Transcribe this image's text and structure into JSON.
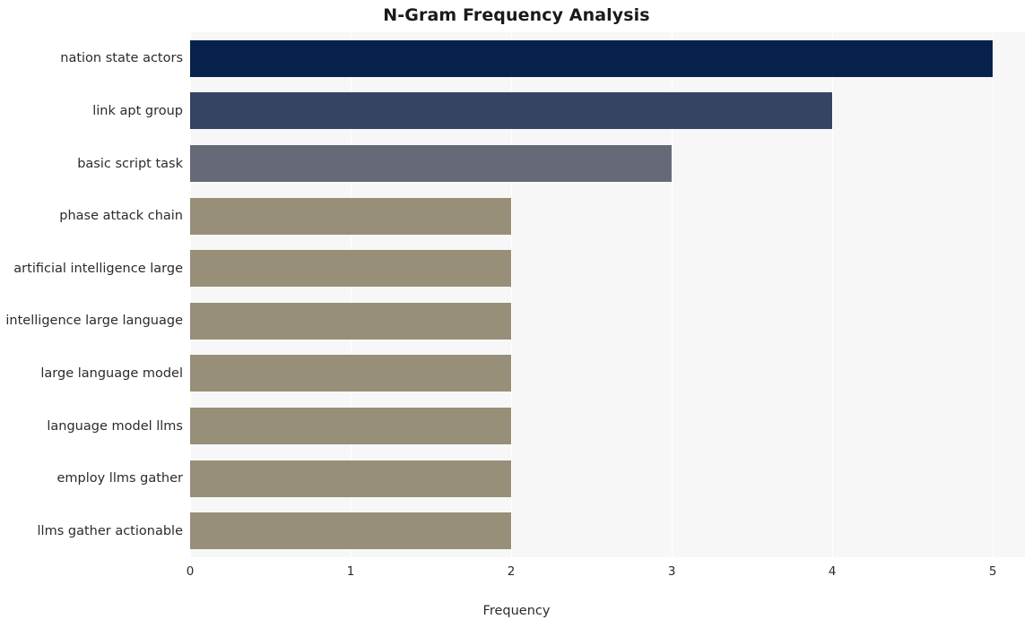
{
  "chart_data": {
    "type": "bar",
    "orientation": "horizontal",
    "title": "N-Gram Frequency Analysis",
    "xlabel": "Frequency",
    "ylabel": "",
    "categories": [
      "nation state actors",
      "link apt group",
      "basic script task",
      "phase attack chain",
      "artificial intelligence large",
      "intelligence large language",
      "large language model",
      "language model llms",
      "employ llms gather",
      "llms gather actionable"
    ],
    "values": [
      5,
      4,
      3,
      2,
      2,
      2,
      2,
      2,
      2,
      2
    ],
    "bar_colors": [
      "#06214b",
      "#374363",
      "#666a78",
      "#978f77",
      "#978f77",
      "#978f77",
      "#978f77",
      "#978f77",
      "#978f77",
      "#978f77"
    ],
    "xlim": [
      0,
      5.2
    ],
    "xticks": [
      0,
      1,
      2,
      3,
      4,
      5
    ],
    "xtick_labels": [
      "0",
      "1",
      "2",
      "3",
      "4",
      "5"
    ],
    "grid": true,
    "grid_color": "#ffffff",
    "plot_background": "#f7f7f7",
    "figure_background": "#ffffff",
    "legend": null
  }
}
